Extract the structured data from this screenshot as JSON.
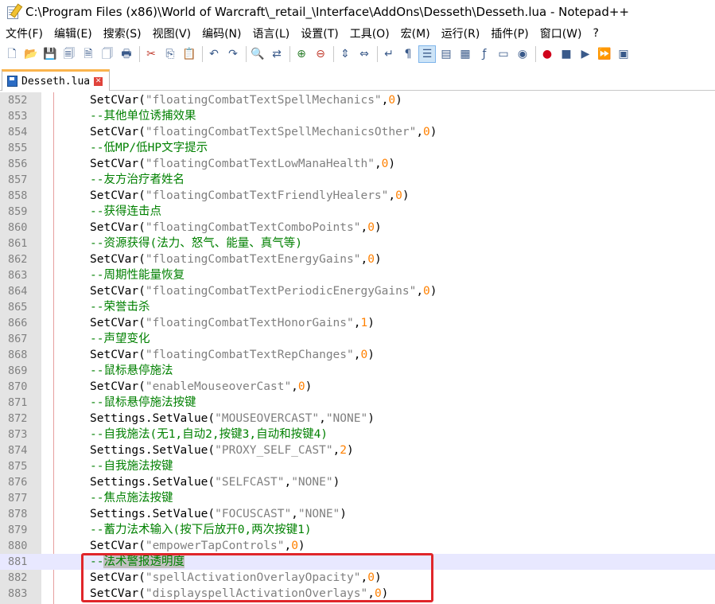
{
  "window": {
    "title": "C:\\Program Files (x86)\\World of Warcraft\\_retail_\\Interface\\AddOns\\Desseth\\Desseth.lua - Notepad++"
  },
  "menu": [
    {
      "label": "文件(F)"
    },
    {
      "label": "编辑(E)"
    },
    {
      "label": "搜索(S)"
    },
    {
      "label": "视图(V)"
    },
    {
      "label": "编码(N)"
    },
    {
      "label": "语言(L)"
    },
    {
      "label": "设置(T)"
    },
    {
      "label": "工具(O)"
    },
    {
      "label": "宏(M)"
    },
    {
      "label": "运行(R)"
    },
    {
      "label": "插件(P)"
    },
    {
      "label": "窗口(W)"
    },
    {
      "label": "?"
    }
  ],
  "toolbar": {
    "icons": [
      "new-file-icon",
      "open-file-icon",
      "save-icon",
      "save-all-icon",
      "close-icon",
      "close-all-icon",
      "print-icon",
      "cut-icon",
      "copy-icon",
      "paste-icon",
      "undo-icon",
      "redo-icon",
      "find-icon",
      "replace-icon",
      "zoom-in-icon",
      "zoom-out-icon",
      "sync-vertical-icon",
      "sync-horizontal-icon",
      "word-wrap-icon",
      "show-all-chars-icon",
      "indent-guide-icon",
      "user-lang-icon",
      "doc-map-icon",
      "function-list-icon",
      "folder-workspace-icon",
      "monitoring-icon",
      "record-macro-icon",
      "stop-macro-icon",
      "play-macro-icon",
      "run-macro-multiple-icon",
      "save-macro-icon"
    ]
  },
  "tab": {
    "label": "Desseth.lua"
  },
  "editor": {
    "colors": {
      "comment": "#008000",
      "string": "#808080",
      "number": "#ff8000",
      "highlight_box": "#e0262a"
    },
    "lines": [
      {
        "num": "852",
        "parts": [
          [
            "fn",
            "SetCVar("
          ],
          [
            "str",
            "\"floatingCombatTextSpellMechanics\""
          ],
          [
            "fn",
            ","
          ],
          [
            "num",
            "0"
          ],
          [
            "fn",
            ")"
          ]
        ]
      },
      {
        "num": "853",
        "parts": [
          [
            "comment",
            "--其他单位诱捕效果"
          ]
        ]
      },
      {
        "num": "854",
        "parts": [
          [
            "fn",
            "SetCVar("
          ],
          [
            "str",
            "\"floatingCombatTextSpellMechanicsOther\""
          ],
          [
            "fn",
            ","
          ],
          [
            "num",
            "0"
          ],
          [
            "fn",
            ")"
          ]
        ]
      },
      {
        "num": "855",
        "parts": [
          [
            "comment",
            "--低MP/低HP文字提示"
          ]
        ]
      },
      {
        "num": "856",
        "parts": [
          [
            "fn",
            "SetCVar("
          ],
          [
            "str",
            "\"floatingCombatTextLowManaHealth\""
          ],
          [
            "fn",
            ","
          ],
          [
            "num",
            "0"
          ],
          [
            "fn",
            ")"
          ]
        ]
      },
      {
        "num": "857",
        "parts": [
          [
            "comment",
            "--友方治疗者姓名"
          ]
        ]
      },
      {
        "num": "858",
        "parts": [
          [
            "fn",
            "SetCVar("
          ],
          [
            "str",
            "\"floatingCombatTextFriendlyHealers\""
          ],
          [
            "fn",
            ","
          ],
          [
            "num",
            "0"
          ],
          [
            "fn",
            ")"
          ]
        ]
      },
      {
        "num": "859",
        "parts": [
          [
            "comment",
            "--获得连击点"
          ]
        ]
      },
      {
        "num": "860",
        "parts": [
          [
            "fn",
            "SetCVar("
          ],
          [
            "str",
            "\"floatingCombatTextComboPoints\""
          ],
          [
            "fn",
            ","
          ],
          [
            "num",
            "0"
          ],
          [
            "fn",
            ")"
          ]
        ]
      },
      {
        "num": "861",
        "parts": [
          [
            "comment",
            "--资源获得(法力、怒气、能量、真气等)"
          ]
        ]
      },
      {
        "num": "862",
        "parts": [
          [
            "fn",
            "SetCVar("
          ],
          [
            "str",
            "\"floatingCombatTextEnergyGains\""
          ],
          [
            "fn",
            ","
          ],
          [
            "num",
            "0"
          ],
          [
            "fn",
            ")"
          ]
        ]
      },
      {
        "num": "863",
        "parts": [
          [
            "comment",
            "--周期性能量恢复"
          ]
        ]
      },
      {
        "num": "864",
        "parts": [
          [
            "fn",
            "SetCVar("
          ],
          [
            "str",
            "\"floatingCombatTextPeriodicEnergyGains\""
          ],
          [
            "fn",
            ","
          ],
          [
            "num",
            "0"
          ],
          [
            "fn",
            ")"
          ]
        ]
      },
      {
        "num": "865",
        "parts": [
          [
            "comment",
            "--荣誉击杀"
          ]
        ]
      },
      {
        "num": "866",
        "parts": [
          [
            "fn",
            "SetCVar("
          ],
          [
            "str",
            "\"floatingCombatTextHonorGains\""
          ],
          [
            "fn",
            ","
          ],
          [
            "num",
            "1"
          ],
          [
            "fn",
            ")"
          ]
        ]
      },
      {
        "num": "867",
        "parts": [
          [
            "comment",
            "--声望变化"
          ]
        ]
      },
      {
        "num": "868",
        "parts": [
          [
            "fn",
            "SetCVar("
          ],
          [
            "str",
            "\"floatingCombatTextRepChanges\""
          ],
          [
            "fn",
            ","
          ],
          [
            "num",
            "0"
          ],
          [
            "fn",
            ")"
          ]
        ]
      },
      {
        "num": "869",
        "parts": [
          [
            "comment",
            "--鼠标悬停施法"
          ]
        ]
      },
      {
        "num": "870",
        "parts": [
          [
            "fn",
            "SetCVar("
          ],
          [
            "str",
            "\"enableMouseoverCast\""
          ],
          [
            "fn",
            ","
          ],
          [
            "num",
            "0"
          ],
          [
            "fn",
            ")"
          ]
        ]
      },
      {
        "num": "871",
        "parts": [
          [
            "comment",
            "--鼠标悬停施法按键"
          ]
        ]
      },
      {
        "num": "872",
        "parts": [
          [
            "fn",
            "Settings.SetValue("
          ],
          [
            "str",
            "\"MOUSEOVERCAST\""
          ],
          [
            "fn",
            ","
          ],
          [
            "str",
            "\"NONE\""
          ],
          [
            "fn",
            ")"
          ]
        ]
      },
      {
        "num": "873",
        "parts": [
          [
            "comment",
            "--自我施法(无1,自动2,按键3,自动和按键4)"
          ]
        ]
      },
      {
        "num": "874",
        "parts": [
          [
            "fn",
            "Settings.SetValue("
          ],
          [
            "str",
            "\"PROXY_SELF_CAST\""
          ],
          [
            "fn",
            ","
          ],
          [
            "num",
            "2"
          ],
          [
            "fn",
            ")"
          ]
        ]
      },
      {
        "num": "875",
        "parts": [
          [
            "comment",
            "--自我施法按键"
          ]
        ]
      },
      {
        "num": "876",
        "parts": [
          [
            "fn",
            "Settings.SetValue("
          ],
          [
            "str",
            "\"SELFCAST\""
          ],
          [
            "fn",
            ","
          ],
          [
            "str",
            "\"NONE\""
          ],
          [
            "fn",
            ")"
          ]
        ]
      },
      {
        "num": "877",
        "parts": [
          [
            "comment",
            "--焦点施法按键"
          ]
        ]
      },
      {
        "num": "878",
        "parts": [
          [
            "fn",
            "Settings.SetValue("
          ],
          [
            "str",
            "\"FOCUSCAST\""
          ],
          [
            "fn",
            ","
          ],
          [
            "str",
            "\"NONE\""
          ],
          [
            "fn",
            ")"
          ]
        ]
      },
      {
        "num": "879",
        "parts": [
          [
            "comment",
            "--蓄力法术输入(按下后放开0,两次按键1)"
          ]
        ]
      },
      {
        "num": "880",
        "parts": [
          [
            "fn",
            "SetCVar("
          ],
          [
            "str",
            "\"empowerTapControls\""
          ],
          [
            "fn",
            ","
          ],
          [
            "num",
            "0"
          ],
          [
            "fn",
            ")"
          ]
        ]
      },
      {
        "num": "881",
        "current": true,
        "parts": [
          [
            "comment",
            "--"
          ],
          [
            "comment-sel",
            "法术警报透明度"
          ]
        ]
      },
      {
        "num": "882",
        "parts": [
          [
            "fn",
            "SetCVar("
          ],
          [
            "str",
            "\"spellActivationOverlayOpacity\""
          ],
          [
            "fn",
            ","
          ],
          [
            "num",
            "0"
          ],
          [
            "fn",
            ")"
          ]
        ]
      },
      {
        "num": "883",
        "parts": [
          [
            "fn",
            "SetCVar("
          ],
          [
            "str",
            "\"displayspellActivationOverlays\""
          ],
          [
            "fn",
            ","
          ],
          [
            "num",
            "0"
          ],
          [
            "fn",
            ")"
          ]
        ]
      }
    ]
  }
}
